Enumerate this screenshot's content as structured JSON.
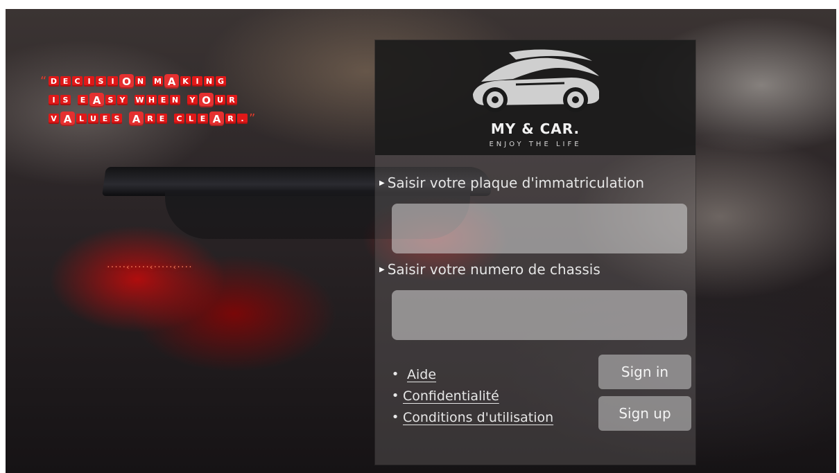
{
  "quote": {
    "open_mark": "“",
    "close_mark": "”",
    "lines": [
      [
        "D",
        "E",
        "C",
        "I",
        "S",
        "I",
        "O",
        "N",
        " ",
        "M",
        "A",
        "K",
        "I",
        "N",
        "G"
      ],
      [
        "I",
        "S",
        " ",
        "E",
        "A",
        "S",
        "Y",
        " ",
        "W",
        "H",
        "E",
        "N",
        " ",
        "Y",
        "O",
        "U",
        "R"
      ],
      [
        "V",
        "A",
        "L",
        "U",
        "E",
        "S",
        " ",
        "A",
        "R",
        "E",
        " ",
        "C",
        "L",
        "E",
        "A",
        "R",
        "."
      ]
    ],
    "highlight_positions": [
      [
        6,
        10
      ],
      [
        4,
        14
      ],
      [
        1,
        7,
        14
      ]
    ]
  },
  "brand": {
    "name": "MY & CAR.",
    "tagline": "ENJOY THE LIFE",
    "logo_icon": "sports-car-icon"
  },
  "form": {
    "plate_label": "Saisir votre plaque d'immatriculation",
    "plate_value": "",
    "chassis_label": "Saisir votre numero de chassis",
    "chassis_value": ""
  },
  "links": {
    "help": "Aide",
    "privacy": "Confidentialité",
    "terms": "Conditions d'utilisation"
  },
  "buttons": {
    "sign_in": "Sign in",
    "sign_up": "Sign up"
  },
  "colors": {
    "quote_tile": "#e01818",
    "panel_header": "#161616",
    "button": "#c8c8c8"
  }
}
